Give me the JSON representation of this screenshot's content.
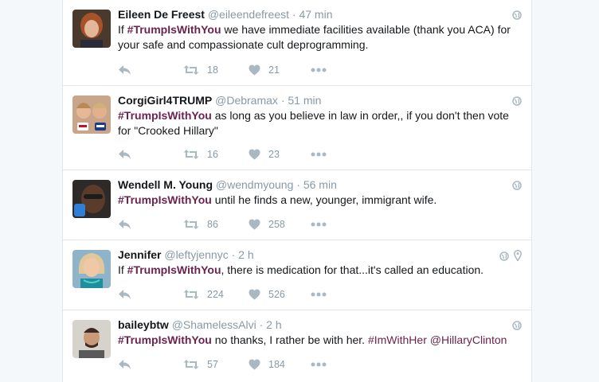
{
  "tweets": [
    {
      "name": "Eileen De Freest",
      "handle": "@eileendefreest",
      "time": "47 min",
      "hashtag": "#TrumpIsWithYou",
      "text_after": " we have immediate facilities available (thank you ACA) for your safe and compassionate cult deprogramming.",
      "retweets": "18",
      "likes": "21"
    },
    {
      "name": "CorgiGirl4TRUMP",
      "handle": "@Debramax",
      "time": "51 min",
      "hashtag": "#TrumpIsWithYou",
      "text_after": " as long as you believe in law in order,, if you don't then vote for \"Crooked Hillary\"",
      "retweets": "16",
      "likes": "23"
    },
    {
      "name": "Wendell M. Young",
      "handle": "@wendmyoung",
      "time": "56 min",
      "hashtag": "#TrumpIsWithYou",
      "text_after": " until he finds a new, younger, immigrant wife.",
      "retweets": "86",
      "likes": "258"
    },
    {
      "name": "Jennifer",
      "handle": "@leftyjennyc",
      "time": "2 h",
      "text_before": "If ",
      "hashtag": "#TrumpIsWithYou",
      "text_after": ", there is medication for that...it's called an education.",
      "retweets": "224",
      "likes": "526"
    },
    {
      "name": "baileybtw",
      "handle": "@ShamelessAlvi",
      "time": "2 h",
      "hashtag": "#TrumpIsWithYou",
      "text_after": " no thanks, I rather be with her. ",
      "hashtag2": "#ImWithHer",
      "mention": "@HillaryClinton",
      "retweets": "57",
      "likes": "184"
    }
  ],
  "tweet0_prefix": "If ",
  "separator": "·",
  "icons": {
    "reply": "reply-icon",
    "retweet": "retweet-icon",
    "like": "heart-icon",
    "more": "more-icon",
    "globe": "globe-icon",
    "location": "location-pin-icon"
  },
  "colors": {
    "hashtag": "#6b2450",
    "name": "#14171a",
    "meta": "#8899a6",
    "icon": "#aab8c2"
  }
}
